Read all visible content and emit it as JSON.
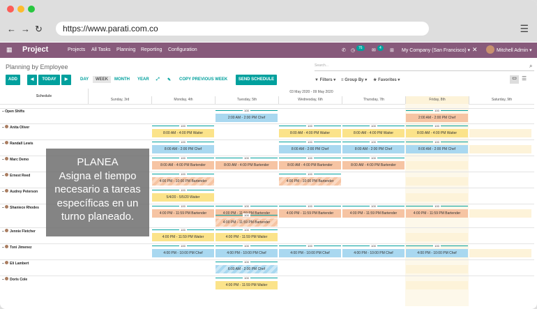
{
  "browser": {
    "url": "https://www.parati.com.co",
    "back": "←",
    "forward": "→",
    "reload": "↻",
    "menu": "☰"
  },
  "topbar": {
    "app": "Project",
    "nav": [
      "Projects",
      "All Tasks",
      "Planning",
      "Reporting",
      "Configuration"
    ],
    "badge1": "76",
    "badge2": "4",
    "company": "My Company (San Francisco) ▾",
    "user": "Mitchell Admin ▾"
  },
  "header": {
    "title": "Planning by Employee",
    "search_placeholder": "Search...",
    "add": "ADD",
    "today": "TODAY",
    "views": [
      "DAY",
      "WEEK",
      "MONTH",
      "YEAR"
    ],
    "copy": "COPY PREVIOUS WEEK",
    "send": "SEND SCHEDULE",
    "filters": "Filters",
    "groupby": "Group By",
    "favorites": "Favorites"
  },
  "grid": {
    "schedule": "Schedule",
    "range": "03 May 2020 - 09 May 2020",
    "days": [
      "Sunday, 3rd",
      "Monday, 4th",
      "Tuesday, 5th",
      "Wednesday, 6th",
      "Thursday, 7th",
      "Friday, 8th",
      "Saturday, 9th"
    ],
    "rows": [
      "Open Shifts",
      "Anita Oliver",
      "Randall Lewis",
      "Marc Demo",
      "Ernest Reed",
      "Audrey Peterson",
      "Shaniece Rhodes",
      "Jennie Fletcher",
      "Toni Jimenez",
      "Eli Lambert",
      "Doris Cole"
    ]
  },
  "shifts": {
    "s1": "2:00 AM - 2:00 PM Chef",
    "s2": "2:00 AM - 2:00 PM Chef",
    "s3": "8:00 AM - 4:00 PM Waiter",
    "s4": "8:00 AM - 4:00 PM Waiter",
    "s5": "8:00 AM - 4:00 PM Waiter",
    "s6": "8:00 AM - 4:00 PM Waiter",
    "s7": "8:00 AM - 2:00 PM Chef",
    "s8": "8:00 AM - 2:00 PM Chef",
    "s9": "8:00 AM - 2:00 PM Chef",
    "s10": "8:00 AM - 2:00 PM Chef",
    "s11": "8:00 AM - 4:00 PM Bartender",
    "s12": "8:00 AM - 4:00 PM Bartender",
    "s13": "8:00 AM - 4:00 PM Bartender",
    "s14": "8:00 AM - 4:00 PM Bartender",
    "s15": "4:00 PM - 10:00 PM Bartender",
    "s16": "4:00 PM - 10:00 PM Bartender",
    "s17": "5/4/20 - 5/5/20 Waiter",
    "s18": "4:00 PM - 11:59 PM Bartender",
    "s19": "4:00 PM - 11:59 PM Bartender",
    "s20": "4:00 PM - 11:59 PM Bartender",
    "s21": "4:00 PM - 11:59 PM Bartender",
    "s22": "4:00 PM - 11:59 PM Bartender",
    "s23": "4:00 PM - 11:59 PM Bartender",
    "s24": "4:00 PM - 11:59 PM Waiter",
    "s25": "4:00 PM - 11:59 PM Waiter",
    "s26": "4:00 PM - 11:59 PM Waiter",
    "s27": "4:00 PM - 11:59 PM Waiter",
    "s28": "4:00 PM - 11:59 PM Waiter",
    "s29": "4:00 PM - 10:00 PM Chef",
    "s30": "4:00 PM - 10:00 PM Chef",
    "s31": "4:00 PM - 10:00 PM Chef",
    "s32": "4:00 PM - 10:00 PM Chef",
    "s33": "4:00 PM - 10:00 PM Chef",
    "s34": "4:00 PM - 10:00 PM Chef",
    "s35": "6:00 AM - 2:00 PM Chef",
    "s36": "4:00 PM - 11:59 PM Waiter",
    "s37": "4:00 PM - 11:59 PM Bartender",
    "s38": "8:00 AM - 4:00 PM Bartender",
    "s39": "4:00 PM - 10:00 PM Bartender"
  },
  "caps": {
    "hundred": "100",
    "twohundred": "200"
  },
  "overlay": {
    "title": "PLANEA",
    "text": "Asigna el tiempo necesario a tareas específicas en un turno planeado."
  },
  "colors": {
    "brand": "#875a7b",
    "accent": "#00a09d"
  }
}
